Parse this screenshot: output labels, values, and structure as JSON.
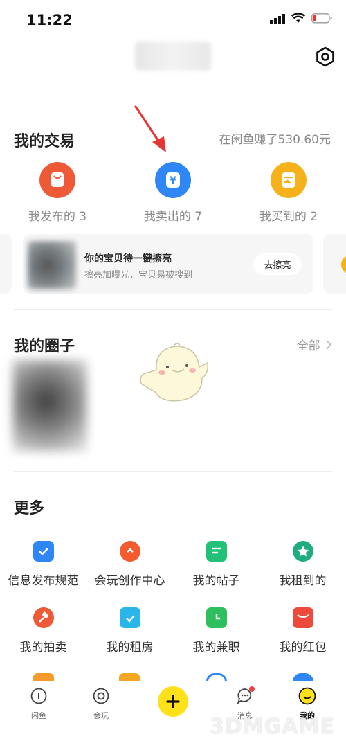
{
  "status_bar": {
    "time": "11:22"
  },
  "trade": {
    "title": "我的交易",
    "earnings": "在闲鱼赚了530.60元",
    "items": [
      {
        "label": "我发布的 3",
        "icon": "bag-icon",
        "color": "#ee5a36"
      },
      {
        "label": "我卖出的 7",
        "icon": "yuan-icon",
        "color": "#2f86f6"
      },
      {
        "label": "我买到的 2",
        "icon": "receipt-icon",
        "color": "#f5b21b"
      }
    ]
  },
  "promo": {
    "title": "你的宝贝待一键擦亮",
    "subtitle": "擦亮加曝光，宝贝易被搜到",
    "button": "去擦亮"
  },
  "circles": {
    "title": "我的圈子",
    "all_link": "全部"
  },
  "more": {
    "title": "更多",
    "items": [
      {
        "label": "信息发布规范",
        "icon": "check-shield-icon",
        "color": "#2f86f6"
      },
      {
        "label": "会玩创作中心",
        "icon": "bulb-icon",
        "color": "#f45b2e"
      },
      {
        "label": "我的帖子",
        "icon": "post-icon",
        "color": "#23c178"
      },
      {
        "label": "我租到的",
        "icon": "badge-icon",
        "color": "#1fae7b"
      },
      {
        "label": "我的拍卖",
        "icon": "hammer-icon",
        "color": "#ee5a36"
      },
      {
        "label": "我的租房",
        "icon": "house-icon",
        "color": "#2bb6ea"
      },
      {
        "label": "我的兼职",
        "icon": "clock-bag-icon",
        "color": "#2fbf5e"
      },
      {
        "label": "我的红包",
        "icon": "redpacket-icon",
        "color": "#ee4a3c"
      }
    ]
  },
  "bottom_nav": {
    "items": [
      {
        "label": "闲鱼",
        "icon": "home-icon"
      },
      {
        "label": "会玩",
        "icon": "target-icon"
      },
      {
        "label": "消息",
        "icon": "chat-icon"
      },
      {
        "label": "我的",
        "icon": "smile-icon"
      }
    ],
    "publish_icon": "plus-icon"
  },
  "watermark": "3DMGAME",
  "colors": {
    "accent": "#ffe11b",
    "arrow": "#e53535",
    "secondary_text": "#8a8a8a"
  }
}
